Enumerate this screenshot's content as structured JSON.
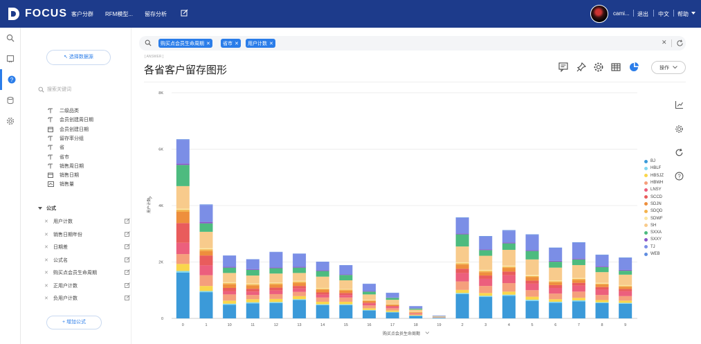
{
  "topbar": {
    "logo_text": "FOCUS",
    "nav": [
      "客户分群",
      "RFM模型...",
      "留存分析"
    ],
    "user": "cami...",
    "logout": "退出",
    "lang": "中文",
    "help": "帮助"
  },
  "left_panel": {
    "select_source": "↖ 选择数据源",
    "search_placeholder": "搜索关键词",
    "fields": [
      {
        "type": "text",
        "label": "二级品类"
      },
      {
        "type": "text",
        "label": "会员创建周日期"
      },
      {
        "type": "date",
        "label": "会员创建日期"
      },
      {
        "type": "text",
        "label": "留存率分组"
      },
      {
        "type": "text",
        "label": "省"
      },
      {
        "type": "text",
        "label": "省市"
      },
      {
        "type": "text",
        "label": "销售周日期"
      },
      {
        "type": "date",
        "label": "销售日期"
      },
      {
        "type": "measure",
        "label": "销售量"
      }
    ],
    "formula_header": "公式",
    "formulas": [
      "用户计数",
      "销售日期年份",
      "日期差",
      "公式名",
      "购买点会员生命周期",
      "正用户计数",
      "负用户计数"
    ],
    "add_formula": "+ 增加公式"
  },
  "search": {
    "chips": [
      "购买点会员生命周期",
      "省市",
      "用户计数"
    ]
  },
  "answer": {
    "tag": "[ ANSWER ]",
    "title": "各省客户留存图形",
    "ops_label": "操作"
  },
  "chart_data": {
    "type": "bar",
    "stacked": true,
    "xlabel": "购买点会员生命周期",
    "ylabel": "用户计数",
    "ylim": [
      0,
      8000
    ],
    "yticks": [
      "0",
      "2K",
      "4K",
      "6K",
      "8K"
    ],
    "grid": true,
    "legend_position": "right",
    "categories": [
      "0",
      "1",
      "10",
      "11",
      "12",
      "13",
      "14",
      "15",
      "16",
      "17",
      "18",
      "19",
      "2",
      "3",
      "4",
      "5",
      "6",
      "7",
      "8",
      "9"
    ],
    "series": [
      {
        "name": "BJ",
        "color": "#3b9ad9",
        "values": [
          1620,
          930,
          480,
          530,
          540,
          650,
          470,
          470,
          280,
          210,
          90,
          20,
          860,
          760,
          800,
          620,
          550,
          600,
          540,
          520
        ]
      },
      {
        "name": "HBLF",
        "color": "#82d7f0",
        "values": [
          60,
          40,
          40,
          40,
          40,
          30,
          30,
          30,
          20,
          20,
          10,
          5,
          40,
          40,
          40,
          40,
          40,
          40,
          30,
          30
        ]
      },
      {
        "name": "HBSJZ",
        "color": "#f9d64c",
        "values": [
          250,
          180,
          110,
          110,
          110,
          110,
          90,
          90,
          60,
          50,
          20,
          5,
          110,
          100,
          110,
          110,
          90,
          90,
          80,
          80
        ]
      },
      {
        "name": "HBWH",
        "color": "#f59f7c",
        "values": [
          350,
          380,
          220,
          150,
          170,
          150,
          150,
          150,
          100,
          80,
          40,
          5,
          300,
          250,
          300,
          230,
          200,
          220,
          180,
          160
        ]
      },
      {
        "name": "LNSY",
        "color": "#ec5f7d",
        "values": [
          400,
          350,
          120,
          120,
          130,
          120,
          100,
          90,
          60,
          50,
          20,
          5,
          300,
          250,
          280,
          230,
          200,
          210,
          190,
          170
        ]
      },
      {
        "name": "SCCD",
        "color": "#e95c5c",
        "values": [
          700,
          350,
          110,
          100,
          100,
          90,
          80,
          70,
          40,
          30,
          10,
          5,
          150,
          120,
          130,
          110,
          100,
          100,
          90,
          80
        ]
      },
      {
        "name": "SDJN",
        "color": "#ee8f3d",
        "values": [
          400,
          160,
          130,
          120,
          110,
          110,
          100,
          90,
          60,
          40,
          20,
          5,
          150,
          120,
          130,
          120,
          100,
          100,
          90,
          80
        ]
      },
      {
        "name": "SDQD",
        "color": "#f3b34d",
        "values": [
          70,
          60,
          40,
          40,
          40,
          40,
          30,
          30,
          20,
          20,
          10,
          5,
          40,
          40,
          40,
          40,
          40,
          40,
          30,
          30
        ]
      },
      {
        "name": "SDWF",
        "color": "#fbe7a4",
        "values": [
          40,
          40,
          30,
          30,
          30,
          30,
          30,
          20,
          20,
          10,
          10,
          5,
          40,
          40,
          40,
          40,
          30,
          30,
          30,
          30
        ]
      },
      {
        "name": "SH",
        "color": "#f8cb8c",
        "values": [
          800,
          580,
          330,
          280,
          320,
          280,
          400,
          310,
          190,
          150,
          80,
          10,
          560,
          500,
          560,
          550,
          450,
          460,
          380,
          370
        ]
      },
      {
        "name": "SXXA",
        "color": "#4dbb7f",
        "values": [
          750,
          300,
          190,
          200,
          190,
          190,
          200,
          190,
          100,
          70,
          40,
          10,
          430,
          200,
          230,
          300,
          210,
          200,
          180,
          140
        ]
      },
      {
        "name": "SXXY",
        "color": "#8a57c9",
        "values": [
          50,
          50,
          30,
          30,
          30,
          30,
          30,
          20,
          20,
          10,
          10,
          5,
          30,
          30,
          30,
          30,
          30,
          30,
          30,
          30
        ]
      },
      {
        "name": "TJ",
        "color": "#7b8ee6",
        "values": [
          840,
          600,
          390,
          340,
          540,
          460,
          290,
          320,
          250,
          160,
          70,
          10,
          550,
          450,
          420,
          540,
          450,
          560,
          390,
          420
        ]
      },
      {
        "name": "WEB",
        "color": "#5f8de0",
        "values": [
          20,
          20,
          10,
          10,
          10,
          10,
          10,
          10,
          10,
          10,
          5,
          5,
          20,
          20,
          20,
          20,
          20,
          20,
          20,
          20
        ]
      }
    ]
  }
}
